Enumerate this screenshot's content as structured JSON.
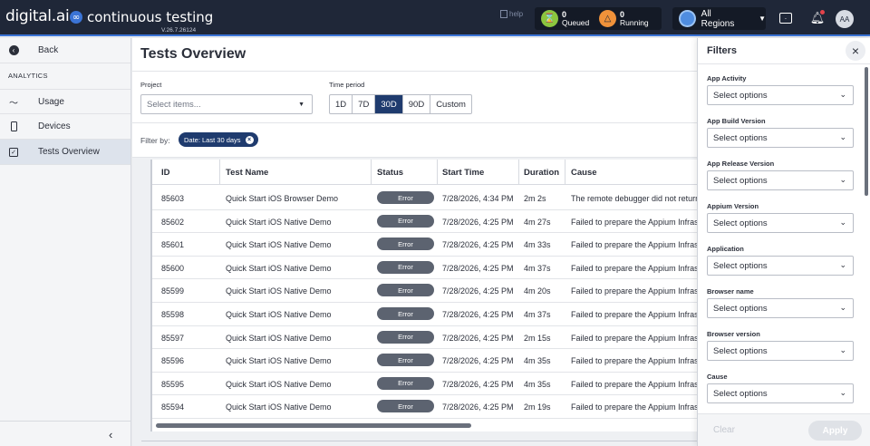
{
  "header": {
    "brand": "digital.ai",
    "product": "continuous testing",
    "version": "V.26.7.26124",
    "help_alt": "help",
    "queued": {
      "count": "0",
      "label": "Queued"
    },
    "running": {
      "count": "0",
      "label": "Running"
    },
    "region": "All Regions",
    "avatar_initials": "AA"
  },
  "sidebar": {
    "back": "Back",
    "section": "ANALYTICS",
    "items": [
      {
        "label": "Usage",
        "icon": "chart-line-icon"
      },
      {
        "label": "Devices",
        "icon": "phone-icon"
      },
      {
        "label": "Tests Overview",
        "icon": "checkbox-icon"
      }
    ],
    "collapse_glyph": "‹"
  },
  "main": {
    "title": "Tests Overview",
    "project_label": "Project",
    "project_placeholder": "Select items...",
    "period_label": "Time period",
    "periods": [
      "1D",
      "7D",
      "30D",
      "90D",
      "Custom"
    ],
    "active_period": "30D",
    "filter_by": "Filter by:",
    "chip": "Date: Last 30 days",
    "columns": [
      "ID",
      "Test Name",
      "Status",
      "Start Time",
      "Duration",
      "Cause"
    ],
    "rows": [
      {
        "id": "85603",
        "name": "Quick Start iOS Browser Demo",
        "status": "Error",
        "start": "7/28/2026, 4:34 PM",
        "duration": "2m 2s",
        "cause": "The remote debugger did not return"
      },
      {
        "id": "85602",
        "name": "Quick Start iOS Native Demo",
        "status": "Error",
        "start": "7/28/2026, 4:25 PM",
        "duration": "4m 27s",
        "cause": "Failed to prepare the Appium Infrastructure"
      },
      {
        "id": "85601",
        "name": "Quick Start iOS Native Demo",
        "status": "Error",
        "start": "7/28/2026, 4:25 PM",
        "duration": "4m 33s",
        "cause": "Failed to prepare the Appium Infrastructure"
      },
      {
        "id": "85600",
        "name": "Quick Start iOS Native Demo",
        "status": "Error",
        "start": "7/28/2026, 4:25 PM",
        "duration": "4m 37s",
        "cause": "Failed to prepare the Appium Infrastructure"
      },
      {
        "id": "85599",
        "name": "Quick Start iOS Native Demo",
        "status": "Error",
        "start": "7/28/2026, 4:25 PM",
        "duration": "4m 20s",
        "cause": "Failed to prepare the Appium Infrastructure"
      },
      {
        "id": "85598",
        "name": "Quick Start iOS Native Demo",
        "status": "Error",
        "start": "7/28/2026, 4:25 PM",
        "duration": "4m 37s",
        "cause": "Failed to prepare the Appium Infrastructure"
      },
      {
        "id": "85597",
        "name": "Quick Start iOS Native Demo",
        "status": "Error",
        "start": "7/28/2026, 4:25 PM",
        "duration": "2m 15s",
        "cause": "Failed to prepare the Appium Infrastructure"
      },
      {
        "id": "85596",
        "name": "Quick Start iOS Native Demo",
        "status": "Error",
        "start": "7/28/2026, 4:25 PM",
        "duration": "4m 35s",
        "cause": "Failed to prepare the Appium Infrastructure"
      },
      {
        "id": "85595",
        "name": "Quick Start iOS Native Demo",
        "status": "Error",
        "start": "7/28/2026, 4:25 PM",
        "duration": "4m 35s",
        "cause": "Failed to prepare the Appium Infrastructure"
      },
      {
        "id": "85594",
        "name": "Quick Start iOS Native Demo",
        "status": "Error",
        "start": "7/28/2026, 4:25 PM",
        "duration": "2m 19s",
        "cause": "Failed to prepare the Appium Infrastructure"
      }
    ]
  },
  "filters": {
    "title": "Filters",
    "groups": [
      {
        "label": "App Activity",
        "placeholder": "Select options"
      },
      {
        "label": "App Build Version",
        "placeholder": "Select options"
      },
      {
        "label": "App Release Version",
        "placeholder": "Select options"
      },
      {
        "label": "Appium Version",
        "placeholder": "Select options"
      },
      {
        "label": "Application",
        "placeholder": "Select options"
      },
      {
        "label": "Browser name",
        "placeholder": "Select options"
      },
      {
        "label": "Browser version",
        "placeholder": "Select options"
      },
      {
        "label": "Cause",
        "placeholder": "Select options"
      }
    ],
    "clear": "Clear",
    "apply": "Apply"
  },
  "colors": {
    "topbar": "#1f2738",
    "accent": "#1f3b6e",
    "status_error": "#5c6370"
  }
}
